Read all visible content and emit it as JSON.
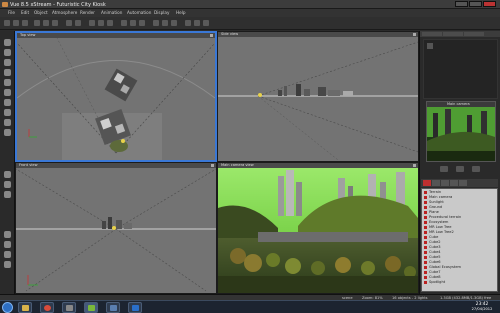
{
  "window": {
    "title": "Vue 8.5 xStream - Futuristic City Kiosk"
  },
  "menus": [
    "File",
    "Edit",
    "Object",
    "Atmosphere",
    "Render",
    "Animation",
    "Automation",
    "Display",
    "Help"
  ],
  "viewports": {
    "top": {
      "label": "Top view"
    },
    "side": {
      "label": "Side view"
    },
    "front": {
      "label": "Front view"
    },
    "main": {
      "label": "Main camera view"
    }
  },
  "preview": {
    "label": "Main camera"
  },
  "objects": [
    "Terrain",
    "Main camera",
    "Sunlight",
    "Ground",
    "Plane",
    "Procedural terrain",
    "Ecosystem",
    "MR Low Tree",
    "MR Low Tree2",
    "Cube",
    "Cube2",
    "Cube3",
    "Cube4",
    "Cube5",
    "Cube6",
    "Global Ecosystem",
    "Cube7",
    "Cube8",
    "Spotlight"
  ],
  "status": {
    "scene": "scene",
    "zoom": "Zoom: 81%",
    "objects": "16 objects - 2 lights",
    "memory": "1.3GB (432.8MB/1.3GB) free"
  },
  "taskbar": {
    "time": "23:42",
    "date": "27/04/2012",
    "apps": [
      "folder-app",
      "chrome-app",
      "media-app",
      "vue-app",
      "desktop-app",
      "photoshop-app"
    ]
  },
  "colors": {
    "active_viewport": "#3a78d6",
    "object_tab": "#c03030",
    "sky_green": "#7bdc45"
  }
}
